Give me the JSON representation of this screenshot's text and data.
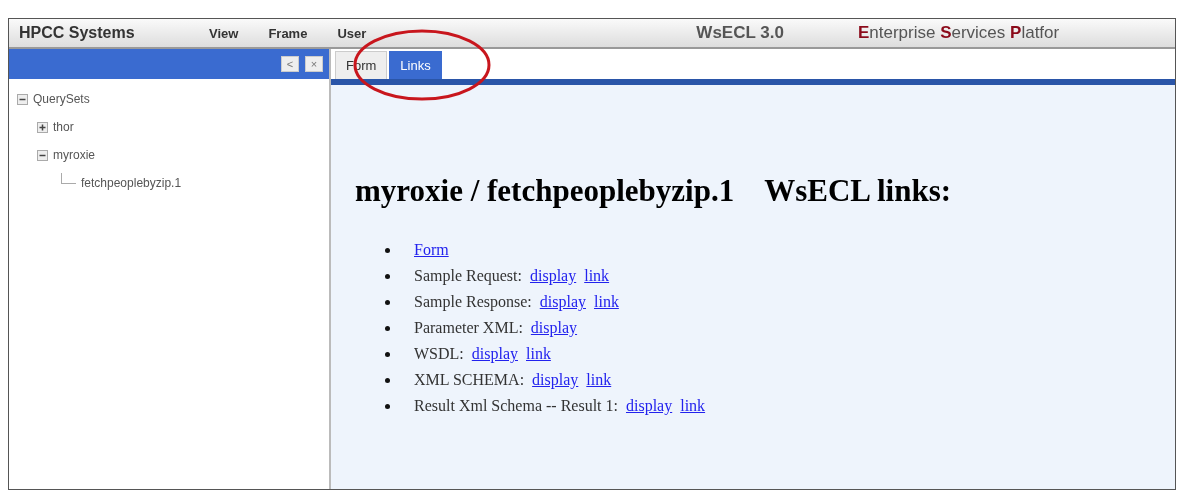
{
  "header": {
    "brand": "HPCC Systems",
    "menu": [
      {
        "label": "View"
      },
      {
        "label": "Frame"
      },
      {
        "label": "User"
      }
    ],
    "version": "WsECL 3.0",
    "tagline": [
      {
        "initial": "E",
        "rest": "nterprise"
      },
      {
        "initial": "S",
        "rest": "ervices"
      },
      {
        "initial": "P",
        "rest": "latfor"
      }
    ]
  },
  "sidebar": {
    "buttons": [
      "<",
      "×"
    ],
    "tree": [
      {
        "label": "QuerySets",
        "expanded": true,
        "children": [
          {
            "label": "thor",
            "expanded": false
          },
          {
            "label": "myroxie",
            "expanded": true,
            "children": [
              {
                "label": "fetchpeoplebyzip.1"
              }
            ]
          }
        ]
      }
    ]
  },
  "tabs": [
    {
      "label": "Form",
      "selected": false
    },
    {
      "label": "Links",
      "selected": true
    }
  ],
  "content": {
    "heading": "myroxie / fetchpeoplebyzip.1",
    "heading_suffix": "WsECL links:",
    "items": [
      {
        "links": [
          "Form"
        ]
      },
      {
        "label": "Sample Request:",
        "links": [
          "display",
          "link"
        ]
      },
      {
        "label": "Sample Response:",
        "links": [
          "display",
          "link"
        ]
      },
      {
        "label": "Parameter XML:",
        "links": [
          "display"
        ]
      },
      {
        "label": "WSDL:",
        "links": [
          "display",
          "link"
        ]
      },
      {
        "label": "XML SCHEMA:",
        "links": [
          "display",
          "link"
        ]
      },
      {
        "label": "Result Xml Schema -- Result 1:",
        "links": [
          "display",
          "link"
        ]
      }
    ]
  }
}
